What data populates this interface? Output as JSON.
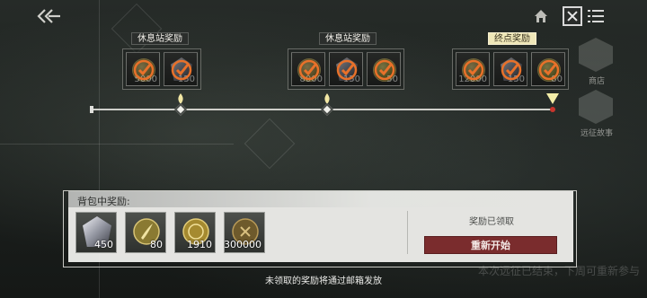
{
  "milestones": [
    {
      "title": "休息站奖励",
      "final": false,
      "rewards": [
        {
          "icon": "gold-coin-icon",
          "qty": "5000",
          "claimed": true
        },
        {
          "icon": "crystal-gem-icon",
          "qty": "150",
          "claimed": true
        }
      ]
    },
    {
      "title": "休息站奖励",
      "final": false,
      "rewards": [
        {
          "icon": "gold-coin-icon",
          "qty": "8000",
          "claimed": true
        },
        {
          "icon": "crystal-gem-icon",
          "qty": "150",
          "claimed": true
        },
        {
          "icon": "badge-coin-icon",
          "qty": "50",
          "claimed": true
        }
      ]
    },
    {
      "title": "终点奖励",
      "final": true,
      "rewards": [
        {
          "icon": "gold-coin-icon",
          "qty": "12000",
          "claimed": true
        },
        {
          "icon": "crystal-gem-icon",
          "qty": "150",
          "claimed": true
        },
        {
          "icon": "badge-coin-icon",
          "qty": "80",
          "claimed": true
        }
      ]
    }
  ],
  "side_buttons": [
    "商店",
    "远征故事"
  ],
  "panel": {
    "title": "背包中奖励:",
    "items": [
      {
        "icon": "crystal-gem-icon",
        "qty": "450"
      },
      {
        "icon": "quill-token-icon",
        "qty": "80"
      },
      {
        "icon": "gold-medal-icon",
        "qty": "1910"
      },
      {
        "icon": "bronze-coin-icon",
        "qty": "300000"
      }
    ],
    "claimed_label": "奖励已领取",
    "restart_label": "重新开始"
  },
  "footer_note": "未领取的奖励将通过邮箱发放",
  "ghost_text": "本次远征已结束，下周可重新参与",
  "colors": {
    "accent_check": "#e8712a",
    "restart_button": "#7a2c2d",
    "final_title_bg": "#efe7b8"
  }
}
